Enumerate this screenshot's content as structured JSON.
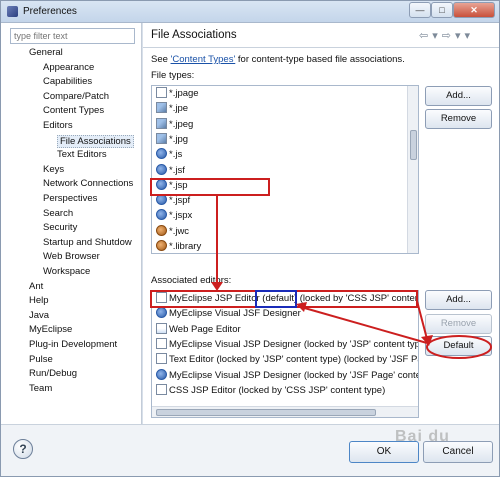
{
  "window": {
    "title": "Preferences"
  },
  "titlebar": {
    "minimize": "—",
    "maximize": "□",
    "close": "✕"
  },
  "filter": {
    "placeholder": "type filter text"
  },
  "tree": [
    {
      "label": "General",
      "level": 1
    },
    {
      "label": "Appearance",
      "level": 2
    },
    {
      "label": "Capabilities",
      "level": 2
    },
    {
      "label": "Compare/Patch",
      "level": 2
    },
    {
      "label": "Content Types",
      "level": 2
    },
    {
      "label": "Editors",
      "level": 2
    },
    {
      "label": "File Associations",
      "level": 3,
      "selected": true
    },
    {
      "label": "Text Editors",
      "level": 3
    },
    {
      "label": "Keys",
      "level": 2
    },
    {
      "label": "Network Connections",
      "level": 2
    },
    {
      "label": "Perspectives",
      "level": 2
    },
    {
      "label": "Search",
      "level": 2
    },
    {
      "label": "Security",
      "level": 2
    },
    {
      "label": "Startup and Shutdow",
      "level": 2
    },
    {
      "label": "Web Browser",
      "level": 2
    },
    {
      "label": "Workspace",
      "level": 2
    },
    {
      "label": "Ant",
      "level": 1
    },
    {
      "label": "Help",
      "level": 1
    },
    {
      "label": "Java",
      "level": 1
    },
    {
      "label": "MyEclipse",
      "level": 1
    },
    {
      "label": "Plug-in Development",
      "level": 1
    },
    {
      "label": "Pulse",
      "level": 1
    },
    {
      "label": "Run/Debug",
      "level": 1
    },
    {
      "label": "Team",
      "level": 1
    }
  ],
  "page": {
    "title": "File Associations",
    "see_prefix": "See ",
    "see_link": "'Content Types'",
    "see_suffix": " for content-type based file associations.",
    "file_types_label": "File types:",
    "associated_label": "Associated editors:"
  },
  "file_types": [
    {
      "label": "*.jpage",
      "icon": "j-page-icon"
    },
    {
      "label": "*.jpe",
      "icon": "image-file-icon"
    },
    {
      "label": "*.jpeg",
      "icon": "image-file-icon"
    },
    {
      "label": "*.jpg",
      "icon": "image-file-icon"
    },
    {
      "label": "*.js",
      "icon": "javascript-icon"
    },
    {
      "label": "*.jsf",
      "icon": "jsf-icon"
    },
    {
      "label": "*.jsp",
      "icon": "jsp-icon",
      "selected": true
    },
    {
      "label": "*.jspf",
      "icon": "jsp-icon"
    },
    {
      "label": "*.jspx",
      "icon": "jsp-icon"
    },
    {
      "label": "*.jwc",
      "icon": "bean-icon"
    },
    {
      "label": "*.library",
      "icon": "bean-icon"
    }
  ],
  "editors": [
    {
      "label": "MyEclipse JSP Editor (default) (locked by 'CSS JSP' content",
      "icon": "jsp-editor-icon",
      "selected": true
    },
    {
      "label": "MyEclipse Visual JSF Designer",
      "icon": "visual-designer-icon"
    },
    {
      "label": "Web Page Editor",
      "icon": "web-page-icon"
    },
    {
      "label": "MyEclipse Visual JSP Designer (locked by 'JSP' content type",
      "icon": "jsp-editor-icon"
    },
    {
      "label": "Text Editor (locked by 'JSP' content type) (locked by 'JSF Pa",
      "icon": "text-file-icon"
    },
    {
      "label": "MyEclipse Visual JSP Designer (locked by 'JSF Page' conten",
      "icon": "visual-designer-icon"
    },
    {
      "label": "CSS JSP Editor (locked by 'CSS JSP' content type)",
      "icon": "text-file-icon"
    }
  ],
  "buttons": {
    "add1": "Add...",
    "remove1": "Remove",
    "add2": "Add...",
    "remove2": "Remove",
    "default": "Default",
    "ok": "OK",
    "cancel": "Cancel"
  },
  "watermark": "Bai du",
  "colors": {
    "highlight_red": "#cc1f1f",
    "highlight_blue": "#1a2bb8",
    "link": "#1a52a8"
  }
}
